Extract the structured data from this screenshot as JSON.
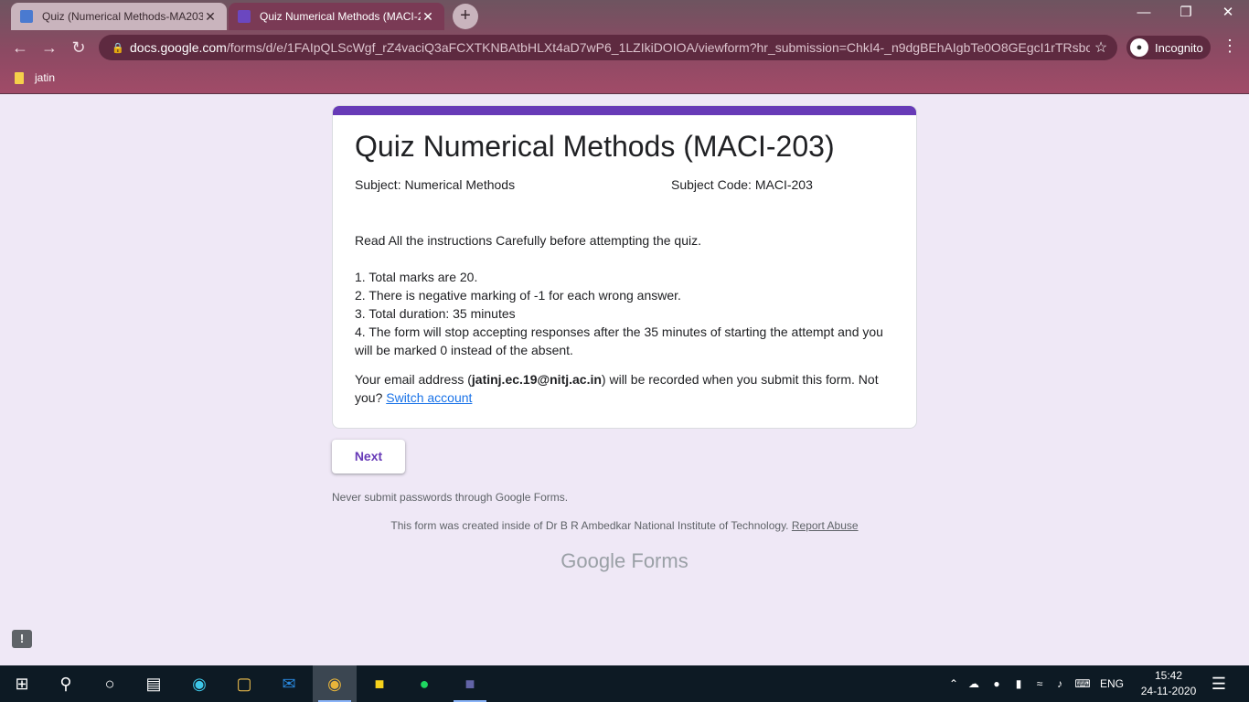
{
  "browser": {
    "tabs": [
      {
        "title": "Quiz (Numerical Methods-MA203",
        "close": "✕"
      },
      {
        "title": "Quiz Numerical Methods (MACI-203",
        "close": "✕"
      }
    ],
    "new_tab": "+",
    "url_domain": "docs.google.com",
    "url_rest": "/forms/d/e/1FAIpQLScWgf_rZ4vaciQ3aFCXTKNBAtbHLXt4aD7wP6_1LZIkiDOIOA/viewform?hr_submission=ChkI4-_n9dgBEhAIgbTe0O8GEgcI1rTRsbcEE...",
    "profile_label": "Incognito",
    "bookmark": "jatin"
  },
  "form": {
    "title": "Quiz Numerical Methods (MACI-203)",
    "subject": "Subject: Numerical Methods",
    "subject_code": "Subject Code: MACI-203",
    "intro": "Read All the instructions Carefully before attempting the quiz.",
    "rules": [
      "1. Total marks are 20.",
      "2. There is negative marking of -1 for each wrong answer.",
      "3. Total duration: 35 minutes",
      "4. The form will stop accepting responses after the 35 minutes of starting the attempt and you will be marked 0 instead of the absent."
    ],
    "email_prefix": "Your email address (",
    "email": "jatinj.ec.19@nitj.ac.in",
    "email_suffix": ") will be recorded when you submit this form. Not you?",
    "switch_account": "Switch account",
    "next_label": "Next",
    "warning": "Never submit passwords through Google Forms.",
    "created_text": "This form was created inside of Dr B R Ambedkar National Institute of Technology.",
    "report_abuse": "Report Abuse",
    "brand_google": "Google",
    "brand_forms": "Forms"
  },
  "taskbar": {
    "language": "ENG",
    "time": "15:42",
    "date": "24-11-2020"
  },
  "colors": {
    "accent": "#673ab7",
    "link": "#1a73e8"
  }
}
